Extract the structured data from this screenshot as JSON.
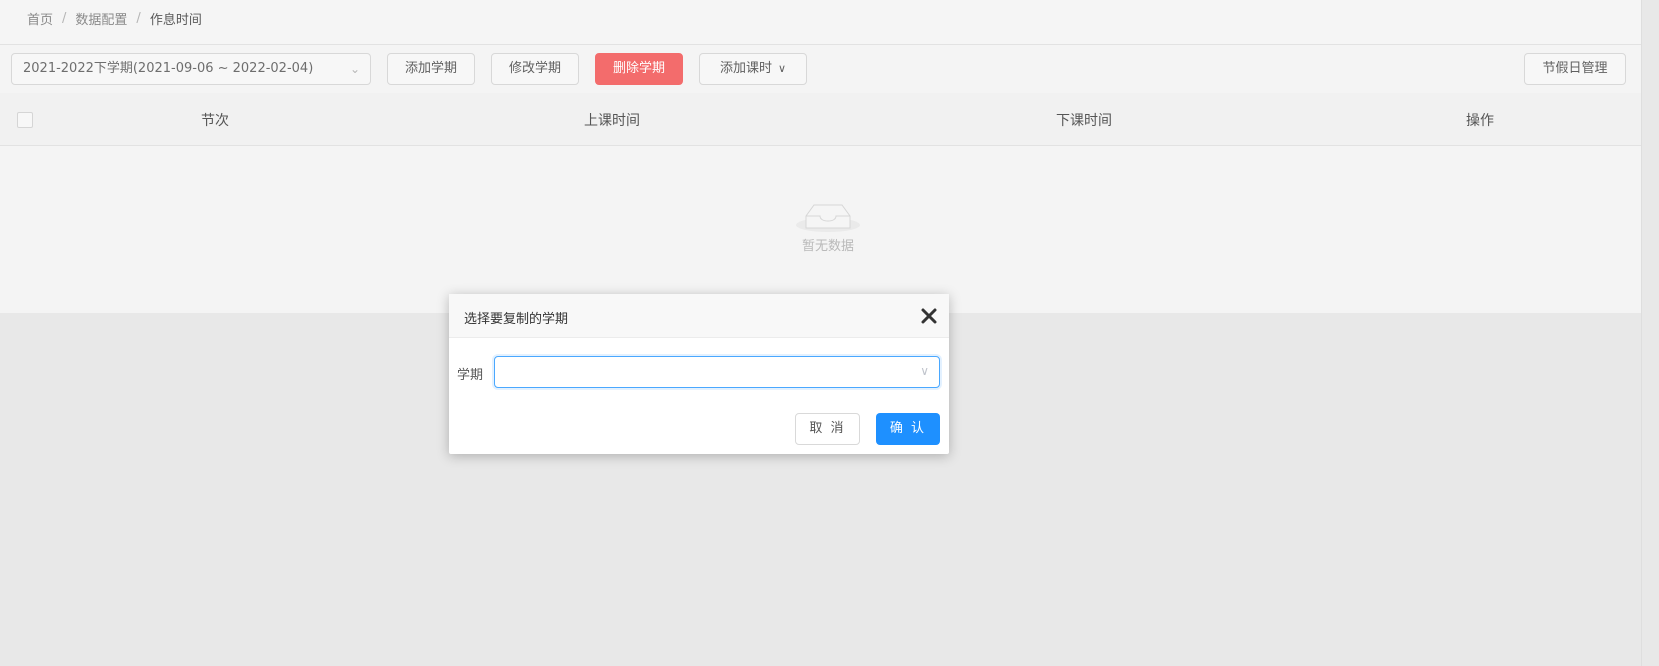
{
  "breadcrumb": {
    "items": [
      "首页",
      "数据配置",
      "作息时间"
    ],
    "separator": "/"
  },
  "toolbar": {
    "term_select_value": "2021-2022下学期(2021-09-06 ~ 2022-02-04)",
    "add_term_label": "添加学期",
    "edit_term_label": "修改学期",
    "delete_term_label": "删除学期",
    "add_period_label": "添加课时",
    "holiday_label": "节假日管理"
  },
  "table": {
    "columns": [
      "节次",
      "上课时间",
      "下课时间",
      "操作"
    ],
    "empty_text": "暂无数据"
  },
  "dialog": {
    "title": "选择要复制的学期",
    "field_label": "学期",
    "field_value": "",
    "cancel_label": "取 消",
    "confirm_label": "确 认"
  },
  "colors": {
    "danger": "#f36c6c",
    "primary": "#1e90ff"
  },
  "icons": {
    "empty": "empty-inbox-icon",
    "close": "close-icon",
    "dropdown": "chevron-down-icon"
  }
}
